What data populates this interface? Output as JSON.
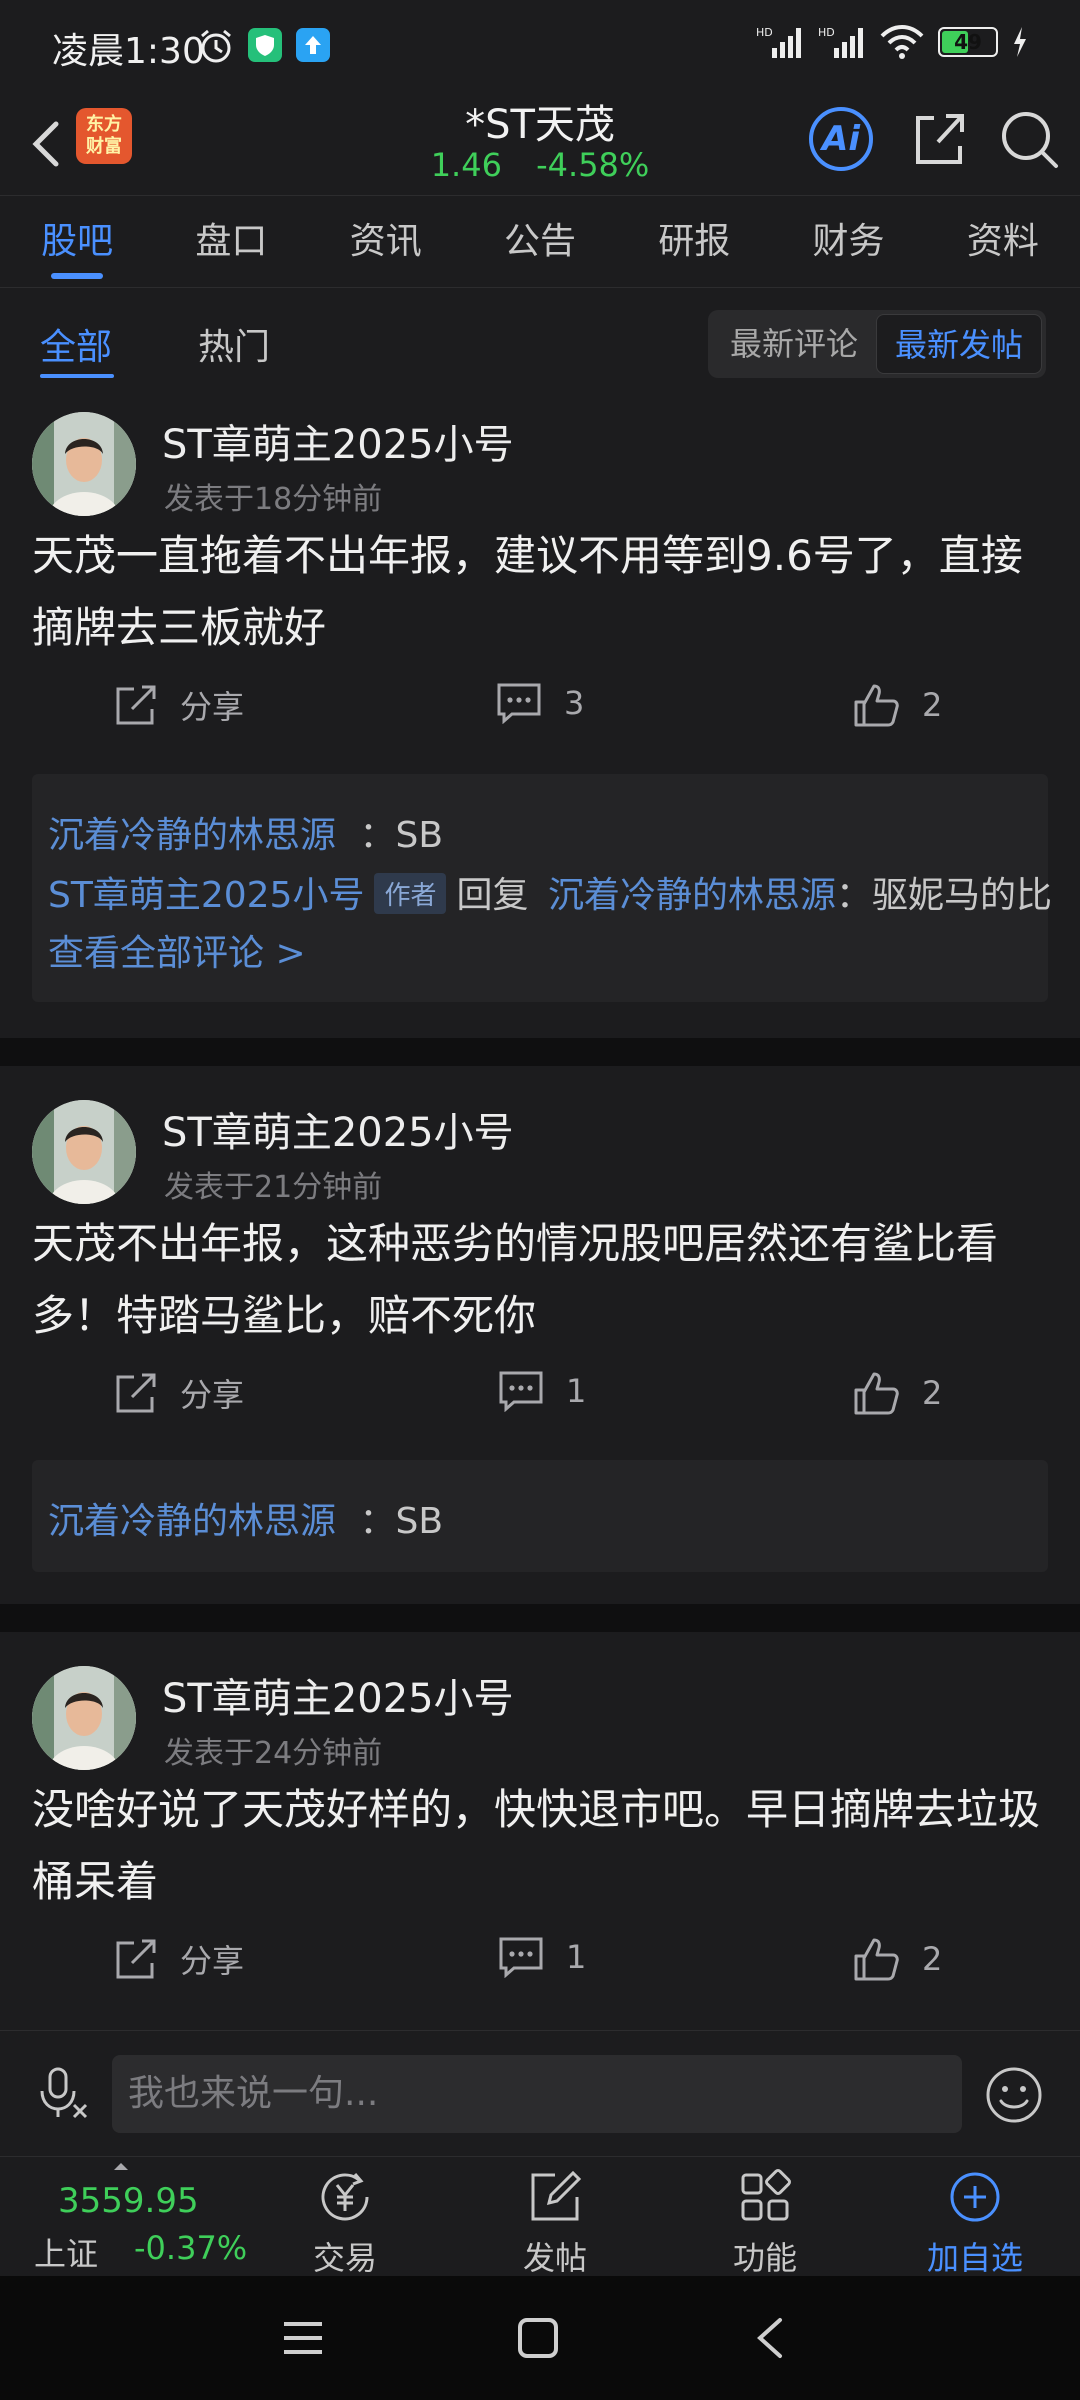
{
  "status_bar": {
    "time": "凌晨1:30",
    "battery": "49",
    "left_icons": [
      "alarm-icon",
      "shield-app-icon",
      "upload-app-icon"
    ],
    "right_icons": [
      "hd-signal-icon",
      "hd-signal-icon",
      "wifi-icon",
      "battery-icon",
      "charging-icon"
    ]
  },
  "header": {
    "logo_text": "东方\n财富",
    "stock_name": "*ST天茂",
    "price": "1.46",
    "change_pct": "-4.58%",
    "ai_label": "Ai"
  },
  "tabs": [
    {
      "label": "股吧",
      "active": true
    },
    {
      "label": "盘口"
    },
    {
      "label": "资讯"
    },
    {
      "label": "公告"
    },
    {
      "label": "研报"
    },
    {
      "label": "财务"
    },
    {
      "label": "资料"
    }
  ],
  "filters": {
    "all": "全部",
    "hot": "热门",
    "latest_comment": "最新评论",
    "latest_post": "最新发帖"
  },
  "posts": [
    {
      "user": "ST章萌主2025小号",
      "time": "发表于18分钟前",
      "content": "天茂一直拖着不出年报，建议不用等到9.6号了，直接摘牌去三板就好",
      "share": "分享",
      "comments": "3",
      "likes": "2",
      "replies": [
        {
          "name": "沉着冷静的林思源",
          "text": "：SB"
        },
        {
          "name": "ST章萌主2025小号",
          "tag": "作者",
          "reply_word": "回复",
          "target": "沉着冷静的林思源",
          "text": "：驱妮马的比"
        }
      ],
      "view_all": "查看全部评论 >"
    },
    {
      "user": "ST章萌主2025小号",
      "time": "发表于21分钟前",
      "content": "天茂不出年报，这种恶劣的情况股吧居然还有鲨比看多！特踏马鲨比，赔不死你",
      "share": "分享",
      "comments": "1",
      "likes": "2",
      "replies": [
        {
          "name": "沉着冷静的林思源",
          "text": "：SB"
        }
      ]
    },
    {
      "user": "ST章萌主2025小号",
      "time": "发表于24分钟前",
      "content": "没啥好说了天茂好样的，快快退市吧。早日摘牌去垃圾桶呆着",
      "share": "分享",
      "comments": "1",
      "likes": "2"
    }
  ],
  "input": {
    "placeholder": "我也来说一句..."
  },
  "bottom_nav": {
    "index_value": "3559.95",
    "index_name": "上证",
    "index_change": "-0.37%",
    "items": [
      {
        "label": "交易",
        "icon": "yen-refresh-icon"
      },
      {
        "label": "发帖",
        "icon": "compose-icon"
      },
      {
        "label": "功能",
        "icon": "grid-icon"
      },
      {
        "label": "加自选",
        "icon": "add-circle-icon"
      }
    ]
  },
  "colors": {
    "accent": "#4a90ff",
    "up_green": "#3fcf5a",
    "background": "#1c1c1e",
    "name_blue": "#5b8ed6"
  }
}
